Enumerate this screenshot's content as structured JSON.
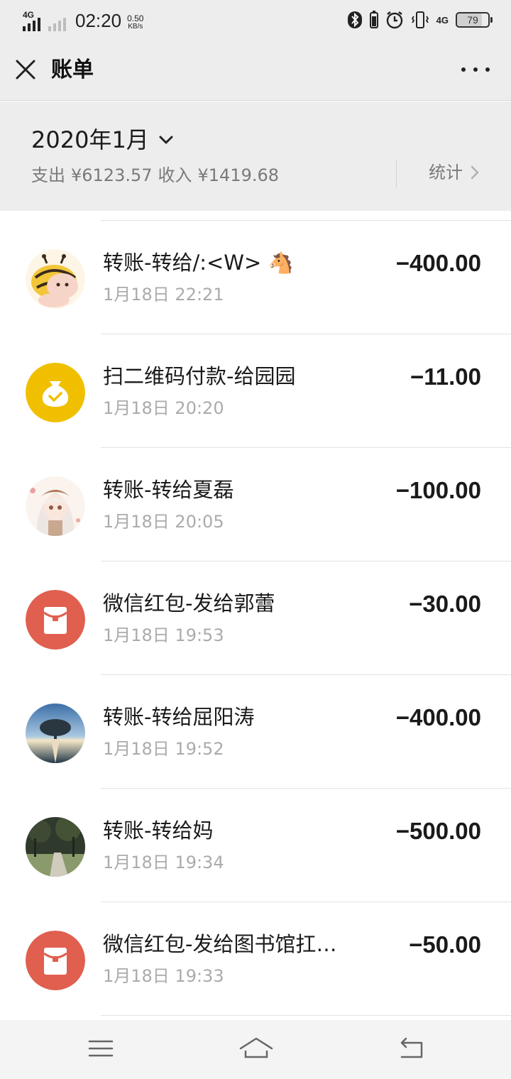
{
  "status_bar": {
    "network_label": "4G",
    "time": "02:20",
    "speed_value": "0.50",
    "speed_unit": "KB/s",
    "network_right": "4G",
    "battery": "79"
  },
  "header": {
    "title": "账单"
  },
  "summary": {
    "month": "2020年1月",
    "expense_label": "支出",
    "expense": "¥6123.57",
    "income_label": "收入",
    "income": "¥1419.68",
    "stats_label": "统计"
  },
  "transactions": [
    {
      "title": "转账-转给/:<W> 🐴",
      "time": "1月18日 22:21",
      "amount": "−400.00",
      "avatar": "cartoon-bee-avatar"
    },
    {
      "title": "扫二维码付款-给园园",
      "time": "1月18日 20:20",
      "amount": "−11.00",
      "avatar": "money-bag-icon"
    },
    {
      "title": "转账-转给夏磊",
      "time": "1月18日 20:05",
      "amount": "−100.00",
      "avatar": "anime-girl-avatar"
    },
    {
      "title": "微信红包-发给郭蕾",
      "time": "1月18日 19:53",
      "amount": "−30.00",
      "avatar": "red-packet-icon"
    },
    {
      "title": "转账-转给屈阳涛",
      "time": "1月18日 19:52",
      "amount": "−400.00",
      "avatar": "tree-sunset-avatar"
    },
    {
      "title": "转账-转给妈",
      "time": "1月18日 19:34",
      "amount": "−500.00",
      "avatar": "park-photo-avatar"
    },
    {
      "title": "微信红包-发给图书馆扛…",
      "time": "1月18日 19:33",
      "amount": "−50.00",
      "avatar": "red-packet-icon"
    }
  ],
  "colors": {
    "background_gray": "#ededed",
    "red_packet": "#e05f4f",
    "money_bag": "#f0c000",
    "secondary_text": "#ababab"
  }
}
